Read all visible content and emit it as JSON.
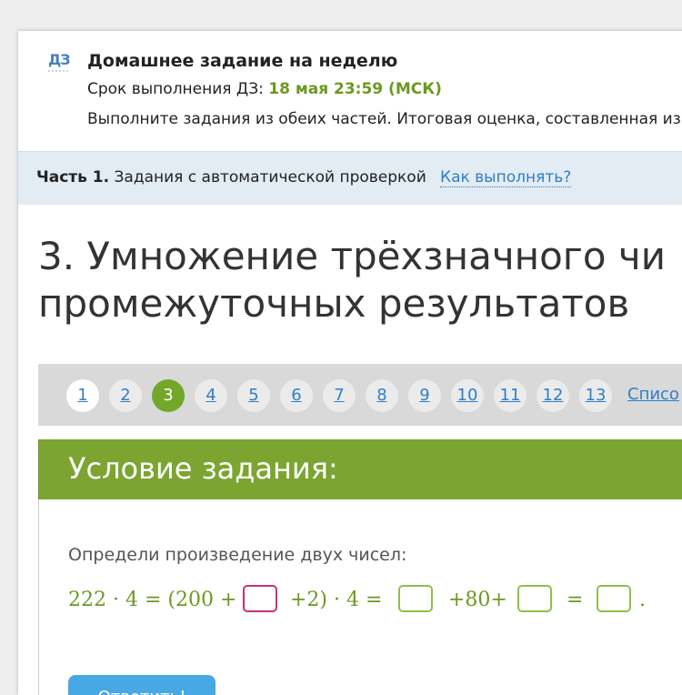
{
  "homework": {
    "icon_label": "ДЗ",
    "title": "Домашнее задание на неделю",
    "deadline_label": "Срок выполнения ДЗ: ",
    "deadline_value": "18 мая 23:59 (МСК)",
    "description": "Выполните задания из обеих частей. Итоговая оценка, составленная из"
  },
  "part": {
    "bold": "Часть 1.",
    "text": " Задания с автоматической проверкой",
    "how_link": "Как выполнять?"
  },
  "task": {
    "title_line1": "3. Умножение трёхзначного чи",
    "title_line2": "промежуточных результатов"
  },
  "pager": {
    "pages": [
      "1",
      "2",
      "3",
      "4",
      "5",
      "6",
      "7",
      "8",
      "9",
      "10",
      "11",
      "12",
      "13"
    ],
    "active": "3",
    "list_link": "Списо"
  },
  "condition": {
    "header": "Условие задания:",
    "text": "Определи произведение двух чисел:",
    "equation": {
      "part_a": "222 · 4 = (200 +",
      "part_b": "+2) · 4 =",
      "part_c": "+80+",
      "part_d": "=",
      "part_e": "."
    }
  },
  "submit": {
    "label": "Ответить!"
  },
  "colors": {
    "accent_green": "#7ba530",
    "link_blue": "#2f7fc6",
    "button_blue": "#48a8e3",
    "focus_pink": "#c2347a"
  }
}
